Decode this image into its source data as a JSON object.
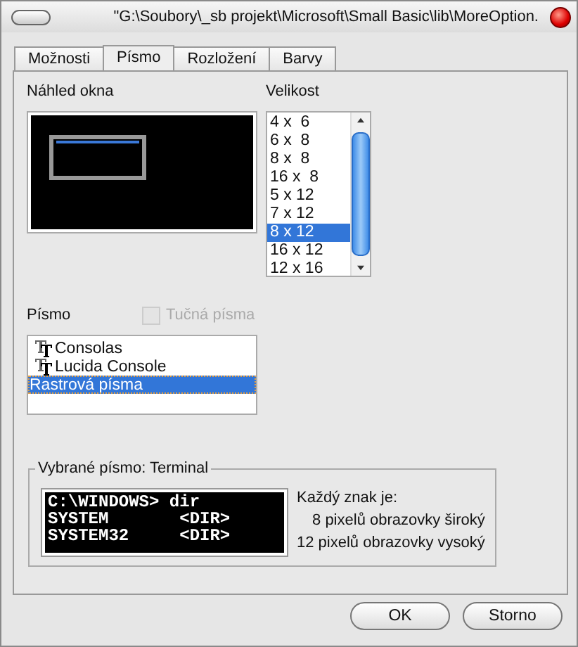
{
  "window": {
    "title": "\"G:\\Soubory\\_sb projekt\\Microsoft\\Small Basic\\lib\\MoreOption."
  },
  "tabs": [
    {
      "label": "Možnosti",
      "selected": false
    },
    {
      "label": "Písmo",
      "selected": true
    },
    {
      "label": "Rozložení",
      "selected": false
    },
    {
      "label": "Barvy",
      "selected": false
    }
  ],
  "preview": {
    "label": "Náhled okna"
  },
  "size": {
    "label": "Velikost",
    "items": [
      {
        "label": "4 x  6",
        "selected": false
      },
      {
        "label": "6 x  8",
        "selected": false
      },
      {
        "label": "8 x  8",
        "selected": false
      },
      {
        "label": "16 x  8",
        "selected": false
      },
      {
        "label": "5 x 12",
        "selected": false
      },
      {
        "label": "7 x 12",
        "selected": false
      },
      {
        "label": "8 x 12",
        "selected": true
      },
      {
        "label": "16 x 12",
        "selected": false
      },
      {
        "label": "12 x 16",
        "selected": false
      }
    ]
  },
  "font": {
    "label": "Písmo",
    "bold": {
      "label": "Tučná písma",
      "checked": false,
      "disabled": true
    },
    "items": [
      {
        "label": "Consolas",
        "kind": "truetype",
        "selected": false
      },
      {
        "label": "Lucida Console",
        "kind": "truetype",
        "selected": false
      },
      {
        "label": "Rastrová písma",
        "kind": "raster",
        "selected": true
      }
    ]
  },
  "selected_font": {
    "legend": "Vybrané písmo: Terminal",
    "sample_lines": [
      "C:\\WINDOWS> dir",
      "SYSTEM       <DIR>",
      "SYSTEM32     <DIR>"
    ],
    "info_heading": "Každý znak je:",
    "info_lines": [
      "8 pixelů obrazovky široký",
      "12 pixelů obrazovky vysoký"
    ]
  },
  "buttons": [
    "OK",
    "Storno"
  ]
}
